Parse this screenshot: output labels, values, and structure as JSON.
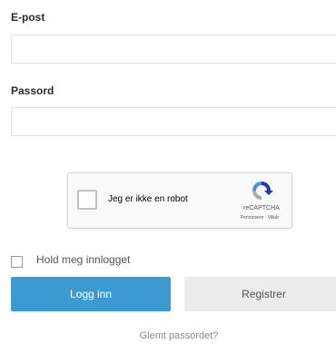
{
  "form": {
    "email_label": "E-post",
    "password_label": "Passord",
    "email_value": "",
    "password_value": ""
  },
  "recaptcha": {
    "label": "Jeg er ikke en robot",
    "brand": "reCAPTCHA",
    "links": "Personvern - Vilkår"
  },
  "remember": {
    "label": "Hold meg innlogget"
  },
  "buttons": {
    "login": "Logg inn",
    "register": "Registrer"
  },
  "forgot_link": "Glemt passordet?",
  "colors": {
    "primary": "#3d9ad1",
    "secondary": "#ececec"
  }
}
